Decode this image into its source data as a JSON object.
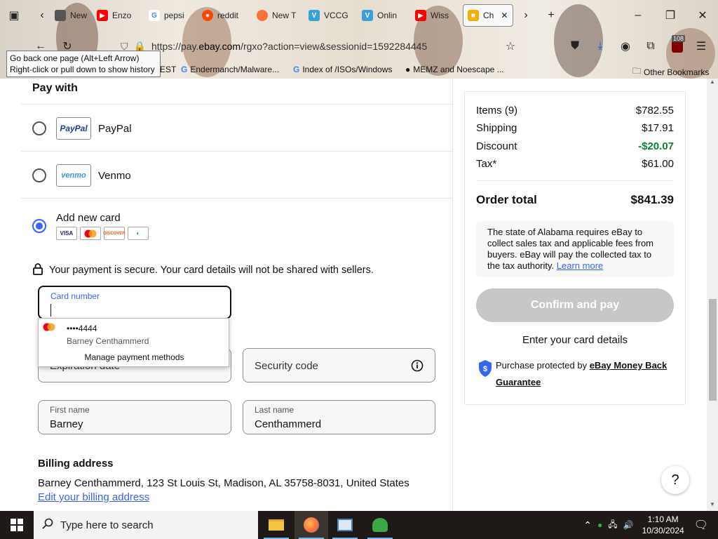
{
  "browser": {
    "tabs": [
      {
        "label": "New",
        "icon": "new-tab-icon",
        "color": "#555555"
      },
      {
        "label": "Enzo",
        "icon": "youtube-icon",
        "color": "#ff0000"
      },
      {
        "label": "pepsi",
        "icon": "google-icon",
        "color": "#4285f4"
      },
      {
        "label": "reddit",
        "icon": "reddit-icon",
        "color": "#ff4500"
      },
      {
        "label": "New T",
        "icon": "firefox-icon",
        "color": "#ff7139"
      },
      {
        "label": "VCCG",
        "icon": "vccg-icon",
        "color": "#3aa1d8"
      },
      {
        "label": "Onlin",
        "icon": "vccg-icon",
        "color": "#3aa1d8"
      },
      {
        "label": "Wiss",
        "icon": "youtube-icon",
        "color": "#ff0000"
      },
      {
        "label": "Ch",
        "icon": "ebay-bag-icon",
        "color": "#f5af02"
      }
    ],
    "url_prefix": "https://pay.",
    "url_domain": "ebay.com",
    "url_suffix": "/rgxo?action=view&sessionid=1592284445",
    "extension_badge": "108",
    "bookmarks": [
      {
        "label": "EST"
      },
      {
        "label": "Endermanch/Malware..."
      },
      {
        "label": "Index of /ISOs/Windows"
      },
      {
        "label": "MEMZ and Noescape ..."
      },
      {
        "label": "Other Bookmarks"
      }
    ],
    "tooltip_line1": "Go back one page (Alt+Left Arrow)",
    "tooltip_line2": "Right-click or pull down to show history"
  },
  "payment": {
    "title": "Pay with",
    "paypal_label": "PayPal",
    "paypal_logo": "PayPal",
    "venmo_label": "Venmo",
    "venmo_logo": "venmo",
    "new_card_label": "Add new card",
    "card_logos": [
      "VISA",
      "MC",
      "DISCOVER",
      "DINERS"
    ],
    "secure_message": "Your payment is secure. Your card details will not be shared with sellers.",
    "card_number_label": "Card number",
    "card_number_value": "",
    "expiration_placeholder": "Expiration date",
    "security_code_placeholder": "Security code",
    "first_name_label": "First name",
    "first_name_value": "Barney",
    "last_name_label": "Last name",
    "last_name_value": "Centhammerd",
    "autofill": {
      "card_number": "••••4444",
      "card_holder": "Barney Centhammerd",
      "manage_label": "Manage payment methods"
    },
    "billing_title": "Billing address",
    "billing_address": "Barney Centhammerd, 123 St Louis St, Madison, AL 35758-8031, United States",
    "billing_edit_label": "Edit your billing address"
  },
  "summary": {
    "items_label": "Items (9)",
    "items_value": "$782.55",
    "shipping_label": "Shipping",
    "shipping_value": "$17.91",
    "discount_label": "Discount",
    "discount_value": "-$20.07",
    "tax_label": "Tax*",
    "tax_value": "$61.00",
    "order_total_label": "Order total",
    "order_total_value": "$841.39",
    "tax_note": "The state of Alabama requires eBay to collect sales tax and applicable fees from buyers. eBay will pay the collected tax to the tax authority.",
    "learn_more_label": "Learn more",
    "confirm_label": "Confirm and pay",
    "enter_details": "Enter your card details",
    "protect_prefix": "Purchase protected by",
    "protect_link": "eBay Money Back Guarantee",
    "help_label": "?"
  },
  "taskbar": {
    "search_placeholder": "Type here to search",
    "time": "1:10 AM",
    "date": "10/30/2024"
  },
  "colors": {
    "accent": "#3665f3",
    "discount_green": "#05823f",
    "disabled_button": "#c7c7c7"
  }
}
